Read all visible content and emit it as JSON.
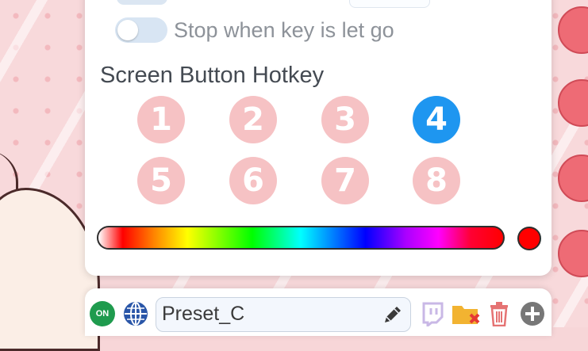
{
  "colors": {
    "accent": "#1e96f0",
    "hotkey_inactive": "#f6c2c4",
    "selected_color": "#ff0000",
    "on_badge": "#1f9b4e"
  },
  "options": {
    "stop_when_key_let_go": {
      "label": "Stop when key is let go",
      "enabled": false
    }
  },
  "hotkey_section": {
    "title": "Screen Button Hotkey",
    "buttons": [
      "1",
      "2",
      "3",
      "4",
      "5",
      "6",
      "7",
      "8"
    ],
    "selected": "4"
  },
  "color_picker": {
    "selected_color": "#ff0000"
  },
  "bottom_bar": {
    "on_label": "ON",
    "preset_value": "Preset_C",
    "icons": [
      "globe-icon",
      "pencil-icon",
      "twitch-icon",
      "folder-remove-icon",
      "trash-icon",
      "add-circle-icon"
    ]
  }
}
